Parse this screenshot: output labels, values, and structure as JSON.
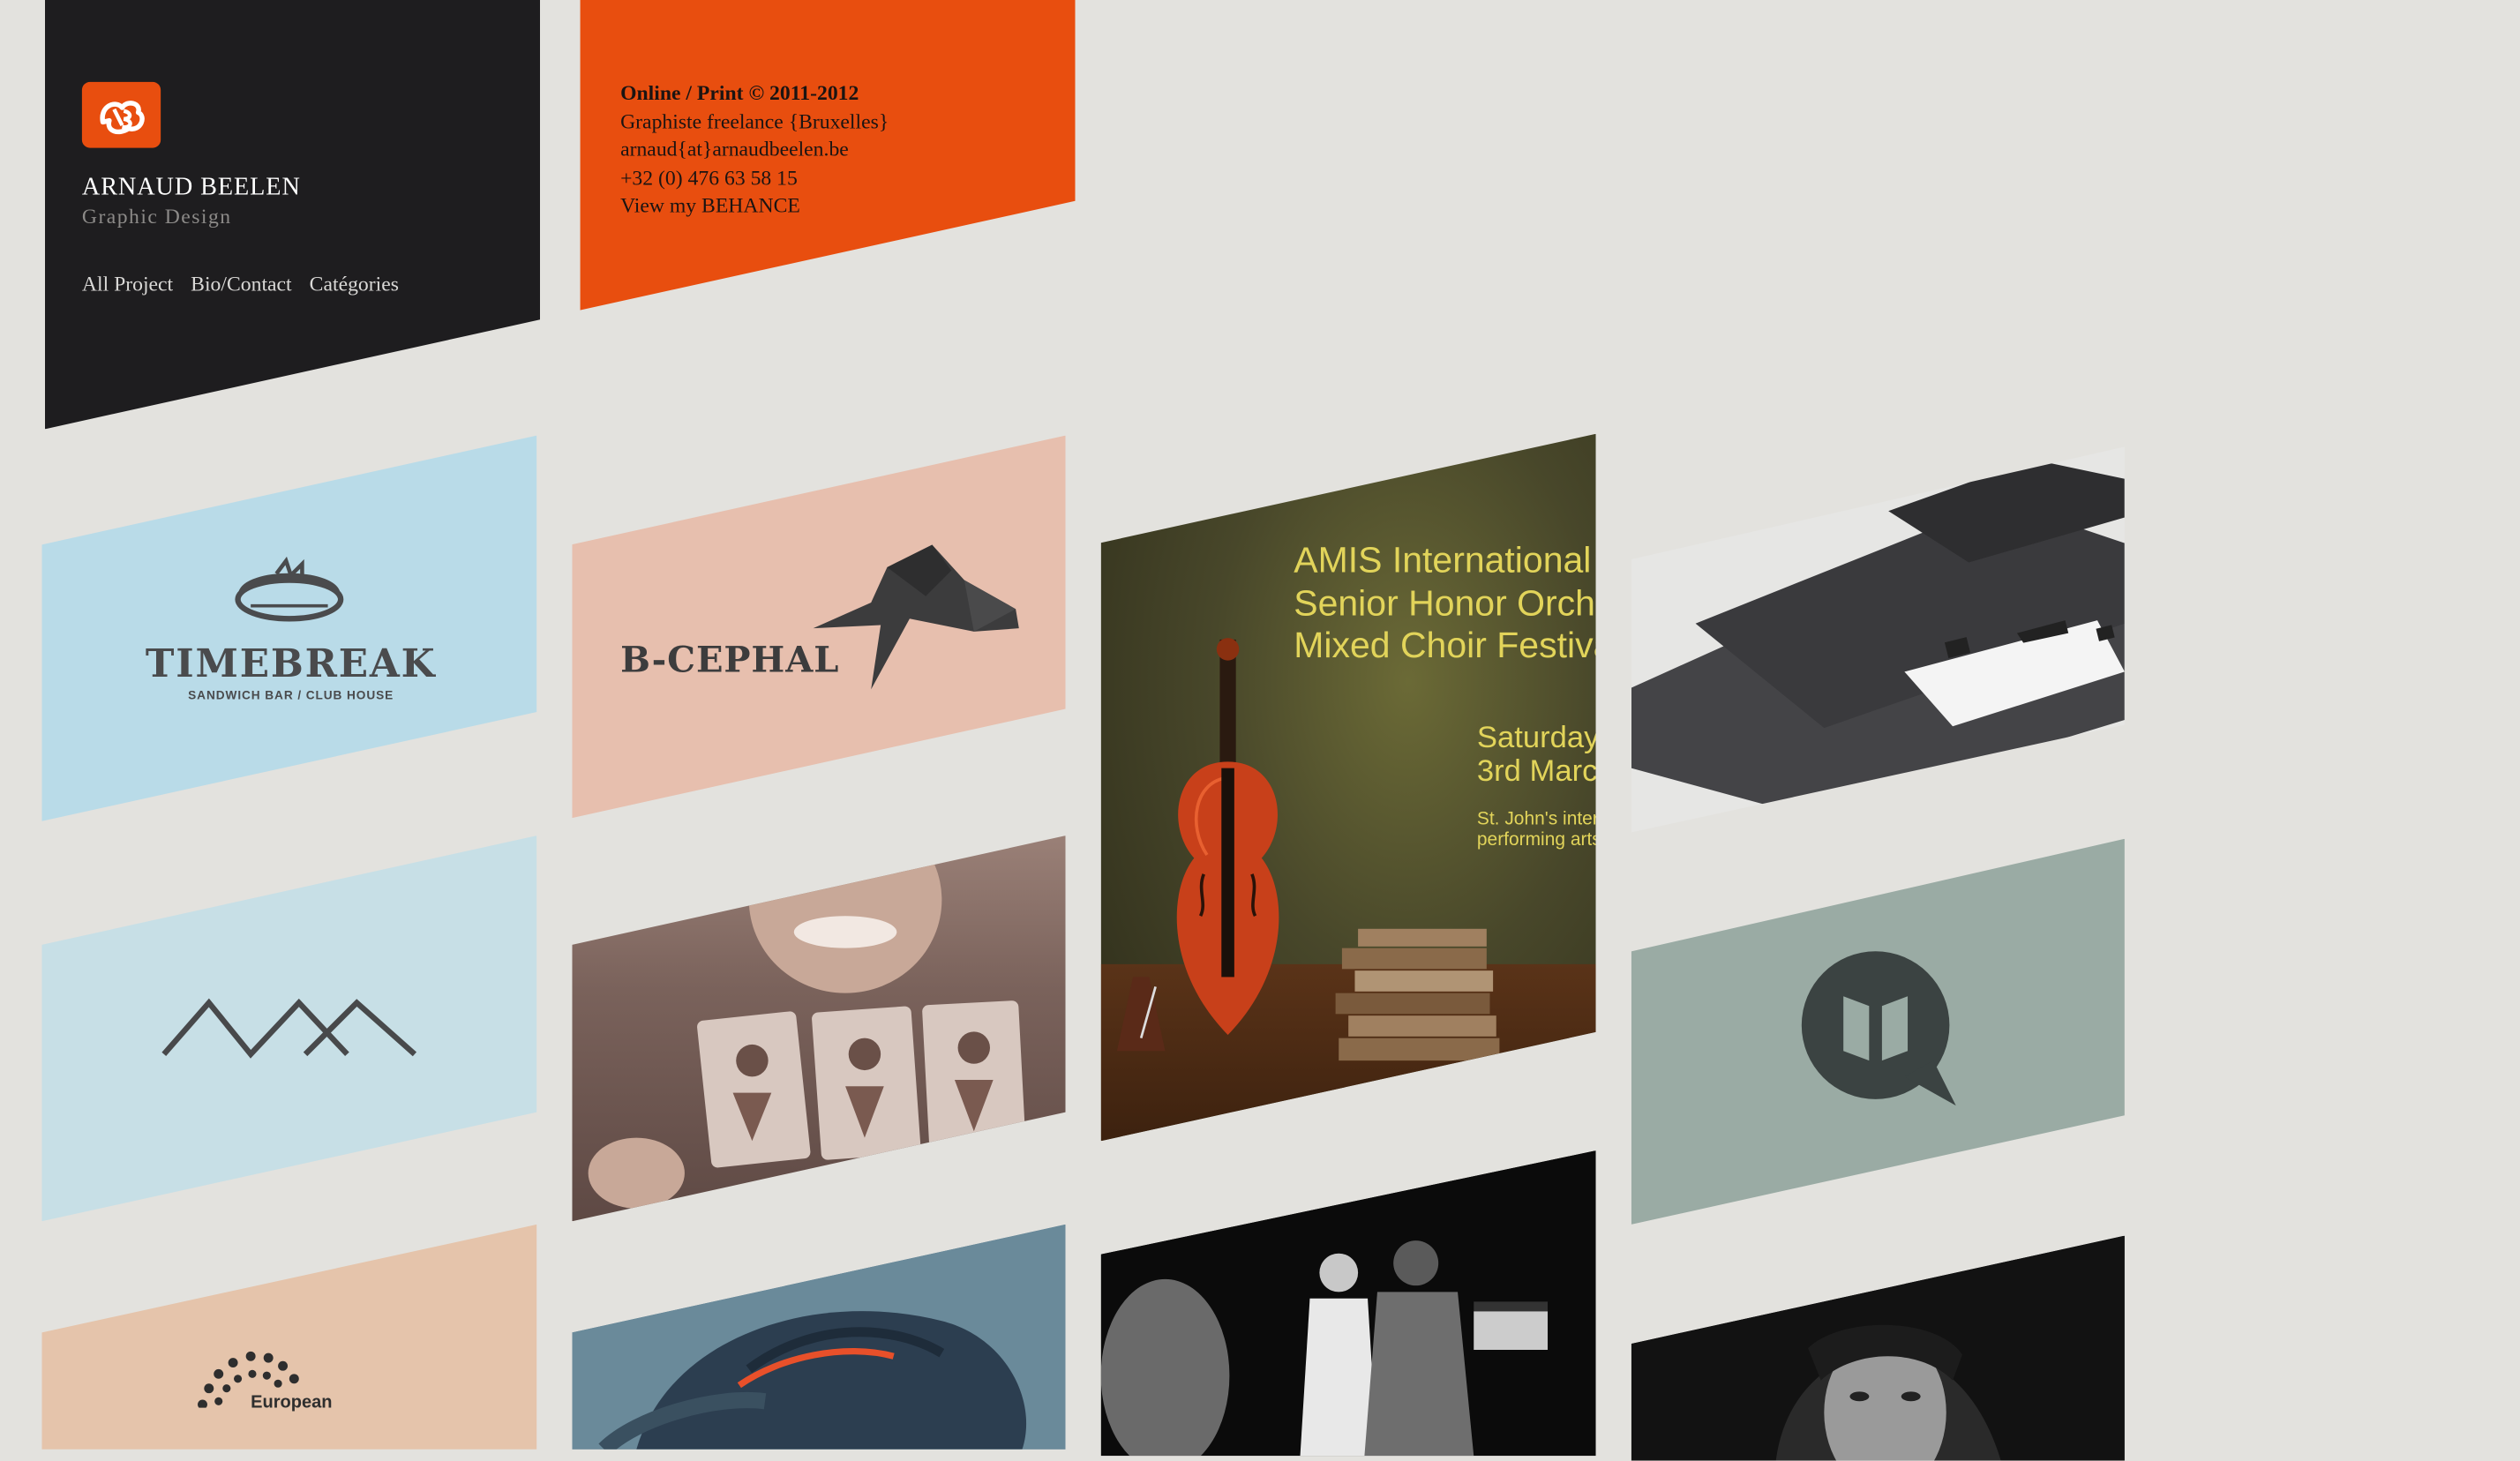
{
  "header": {
    "name": "ARNAUD BEELEN",
    "subtitle": "Graphic Design",
    "nav": [
      "All Project",
      "Bio/Contact",
      "Catégories"
    ]
  },
  "info": {
    "line1": "Online / Print © 2011-2012",
    "line2": "Graphiste freelance {Bruxelles}",
    "line3": "arnaud{at}arnaudbeelen.be",
    "line4": "+32 (0) 476 63 58 15",
    "line5": "View my BEHANCE"
  },
  "tiles": {
    "timebreak": {
      "title": "TIMEBREAK",
      "tagline": "SANDWICH BAR / CLUB HOUSE"
    },
    "bcephal": {
      "title": "B-CEPHAL"
    },
    "amis": {
      "title_lines": [
        "AMIS International",
        "Senior Honor Orche",
        "Mixed Choir Festiva"
      ],
      "date_lines": [
        "Saturday",
        "3rd March"
      ],
      "venue_lines": [
        "St. John's inter",
        "performing arts"
      ]
    },
    "european": {
      "label": "European"
    }
  },
  "colors": {
    "background": "#e3e2de",
    "header_dark": "#1e1d1f",
    "accent_orange": "#e84e0f",
    "timebreak_blue": "#b9dbe8",
    "bcephal_pink": "#e7bfae",
    "quotes_grey_green": "#9aaba4",
    "european_peach": "#e5c4ab"
  }
}
